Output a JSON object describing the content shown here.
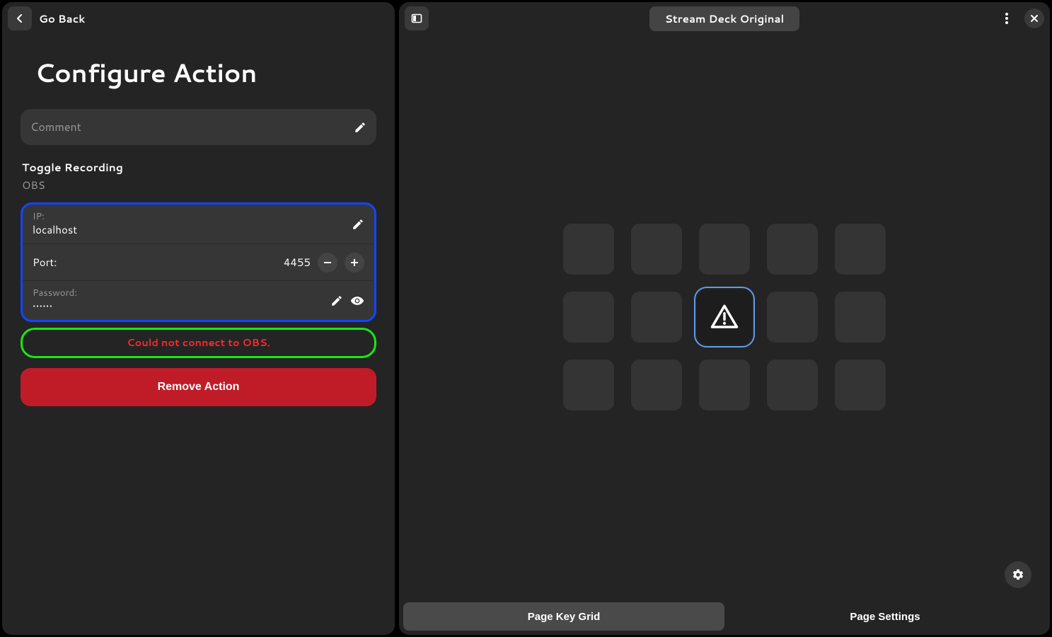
{
  "left": {
    "go_back": "Go Back",
    "title": "Configure Action",
    "comment_placeholder": "Comment",
    "action_name": "Toggle Recording",
    "plugin": "OBS",
    "ip_label": "IP:",
    "ip_value": "localhost",
    "port_label": "Port:",
    "port_value": "4455",
    "password_label": "Password:",
    "password_value": "••••••",
    "error": "Could not connect to OBS.",
    "remove": "Remove Action"
  },
  "right": {
    "device": "Stream Deck Original",
    "tab_grid": "Page Key Grid",
    "tab_settings": "Page Settings",
    "grid": {
      "rows": 3,
      "cols": 5,
      "selected_index": 7
    }
  }
}
